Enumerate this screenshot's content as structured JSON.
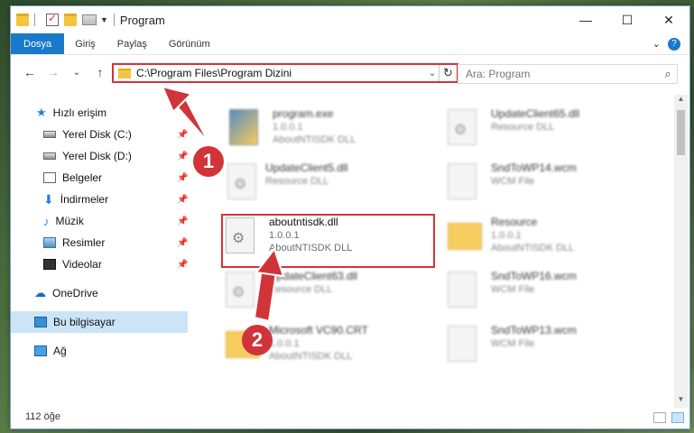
{
  "window": {
    "title": "Program",
    "controls": {
      "minimize": "—",
      "maximize": "☐",
      "close": "✕"
    }
  },
  "ribbon": {
    "tabs": [
      "Dosya",
      "Giriş",
      "Paylaş",
      "Görünüm"
    ],
    "expand": "⌄",
    "help": "?"
  },
  "nav": {
    "back": "←",
    "forward": "→",
    "recent": "⌄",
    "up": "↑"
  },
  "address": {
    "path": "C:\\Program Files\\Program Dizini",
    "chevron": "⌄",
    "refresh": "↻"
  },
  "search": {
    "placeholder": "Ara: Program",
    "icon": "⌕"
  },
  "sidebar": {
    "quick_access": "Hızlı erişim",
    "items": [
      {
        "label": "Yerel Disk (C:)",
        "icon": "drive-icon",
        "pinned": true
      },
      {
        "label": "Yerel Disk (D:)",
        "icon": "drive-icon",
        "pinned": true
      },
      {
        "label": "Belgeler",
        "icon": "documents-icon",
        "pinned": true
      },
      {
        "label": "İndirmeler",
        "icon": "downloads-icon",
        "pinned": true
      },
      {
        "label": "Müzik",
        "icon": "music-icon",
        "pinned": true
      },
      {
        "label": "Resimler",
        "icon": "pictures-icon",
        "pinned": true
      },
      {
        "label": "Videolar",
        "icon": "videos-icon",
        "pinned": true
      }
    ],
    "onedrive": "OneDrive",
    "this_pc": "Bu bilgisayar",
    "network": "Ağ",
    "pin_glyph": "📌"
  },
  "files": [
    {
      "name": "program.exe",
      "line2": "1.0.0.1",
      "line3": "AboutNTISDK DLL",
      "icon": "exe-icon"
    },
    {
      "name": "UpdateClient65.dll",
      "line2": "Resource DLL",
      "line3": "",
      "icon": "dll-icon"
    },
    {
      "name": "UpdateClient5.dll",
      "line2": "Resource DLL",
      "line3": "",
      "icon": "dll-icon"
    },
    {
      "name": "SndToWP14.wcm",
      "line2": "WCM File",
      "line3": "",
      "icon": "file-icon"
    },
    {
      "name": "aboutntisdk.dll",
      "line2": "1.0.0.1",
      "line3": "AboutNTISDK DLL",
      "icon": "dll-icon"
    },
    {
      "name": "Resource",
      "line2": "1.0.0.1",
      "line3": "AboutNTISDK DLL",
      "icon": "folder-icon"
    },
    {
      "name": "UpdateClient63.dll",
      "line2": "Resource DLL",
      "line3": "",
      "icon": "dll-icon"
    },
    {
      "name": "SndToWP16.wcm",
      "line2": "WCM File",
      "line3": "",
      "icon": "file-icon"
    },
    {
      "name": "Microsoft VC90.CRT",
      "line2": "1.0.0.1",
      "line3": "AboutNTISDK DLL",
      "icon": "folder-icon"
    },
    {
      "name": "SndToWP13.wcm",
      "line2": "WCM File",
      "line3": "",
      "icon": "file-icon"
    }
  ],
  "status": {
    "count": "112 öğe"
  },
  "callouts": [
    "1",
    "2"
  ],
  "colors": {
    "accent": "#1979ca",
    "highlight": "#d13438",
    "selected": "#cce4f7"
  }
}
